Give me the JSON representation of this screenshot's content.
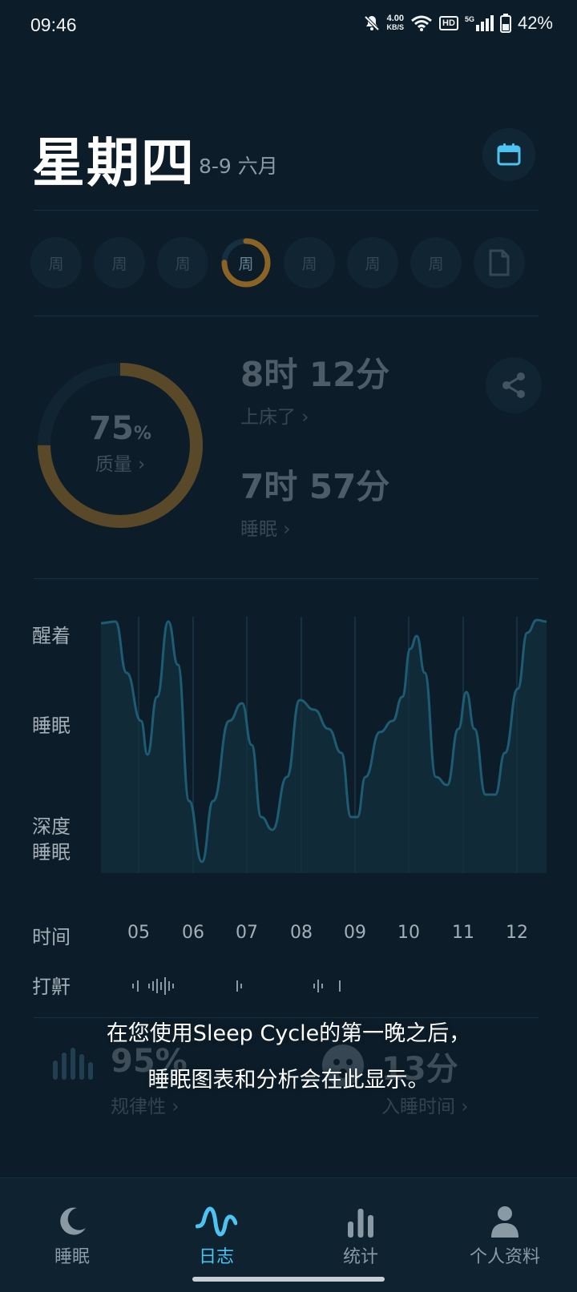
{
  "status_bar": {
    "time": "09:46",
    "net_speed_value": "4.00",
    "net_speed_unit": "KB/S",
    "hd": "HD",
    "signal": "5G",
    "battery": "42%"
  },
  "header": {
    "day": "星期四",
    "date_range": "8-9 六月"
  },
  "week": {
    "days": [
      "周",
      "周",
      "周",
      "周",
      "周",
      "周",
      "周"
    ],
    "selected_index": 3
  },
  "summary": {
    "quality_value": "75",
    "quality_unit": "%",
    "quality_label": "质量 ›",
    "quality_fraction": 0.75,
    "in_bed_value": "8时 12分",
    "in_bed_label": "上床了 ›",
    "asleep_value": "7时 57分",
    "asleep_label": "睡眠 ›"
  },
  "chart_data": {
    "type": "line",
    "y_labels": [
      "醒着",
      "睡眠",
      "深度\n睡眠"
    ],
    "x_axis_title": "时间",
    "x_ticks": [
      "05",
      "06",
      "07",
      "08",
      "09",
      "10",
      "11",
      "12"
    ],
    "colors": {
      "line": "#1d5c73",
      "fill": "#12303e",
      "grid": "#16303f"
    }
  },
  "snore": {
    "label": "打鼾"
  },
  "lower_stats": {
    "regularity_value": "95%",
    "regularity_label": "规律性 ›",
    "fall_asleep_value": "13分",
    "fall_asleep_label": "入睡时间 ›"
  },
  "overlay": {
    "line1": "在您使用Sleep Cycle的第一晚之后，",
    "line2": "睡眠图表和分析会在此显示。"
  },
  "nav": {
    "items": [
      {
        "label": "睡眠",
        "icon": "moon-icon"
      },
      {
        "label": "日志",
        "icon": "pulse-wave-icon"
      },
      {
        "label": "统计",
        "icon": "bar-stats-icon"
      },
      {
        "label": "个人资料",
        "icon": "person-icon"
      }
    ],
    "active_index": 1
  },
  "theme": {
    "background": "#0c1c28",
    "accent": "#4cc3f0",
    "ring": "#8a6325"
  }
}
